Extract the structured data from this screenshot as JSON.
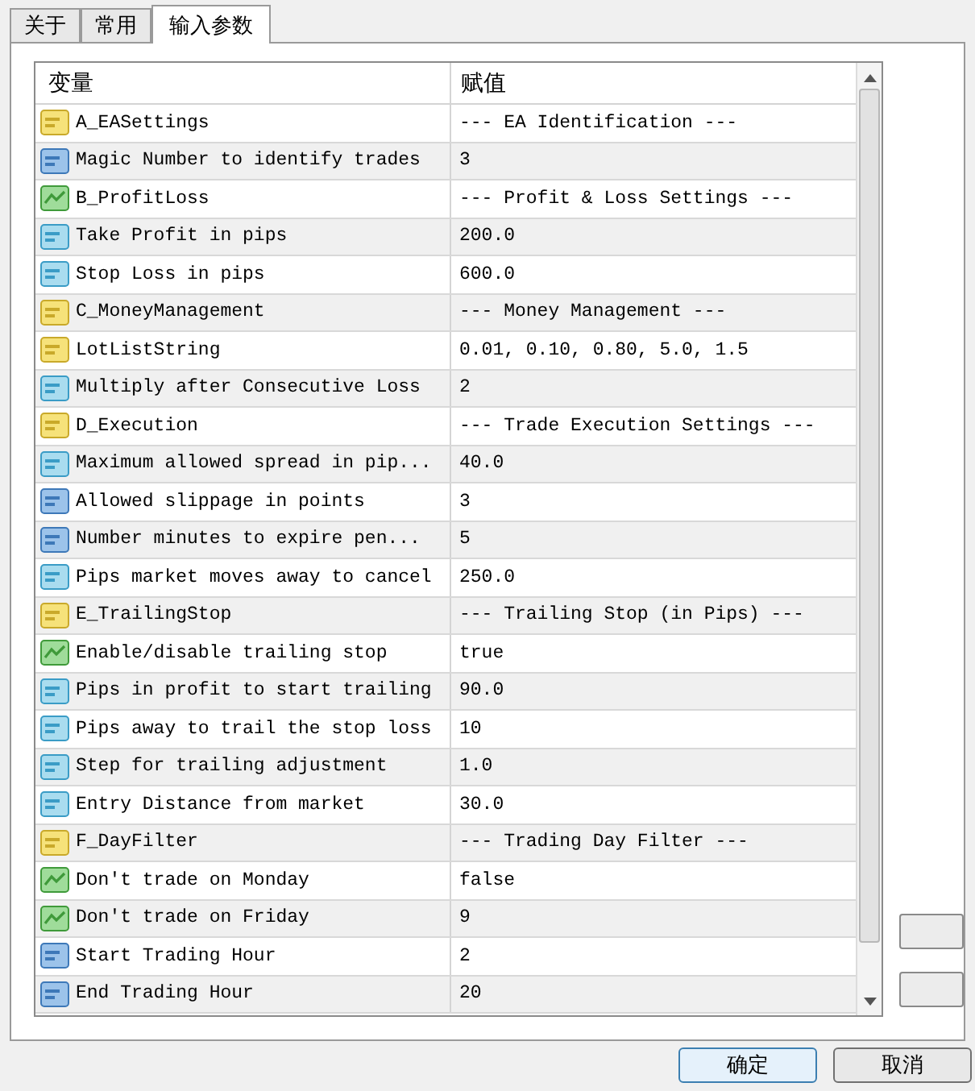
{
  "tabs": [
    {
      "label": "关于",
      "selected": false
    },
    {
      "label": "常用",
      "selected": false
    },
    {
      "label": "输入参数",
      "selected": true
    }
  ],
  "table": {
    "columns": [
      "变量",
      "赋值"
    ],
    "rows": [
      {
        "kind": "string",
        "name": "A_EASettings",
        "value": "--- EA Identification ---"
      },
      {
        "kind": "int",
        "name": "Magic Number to identify trades",
        "value": "3"
      },
      {
        "kind": "bool",
        "name": "B_ProfitLoss",
        "value": "--- Profit & Loss Settings ---"
      },
      {
        "kind": "double",
        "name": "Take Profit in pips",
        "value": "200.0"
      },
      {
        "kind": "double",
        "name": "Stop Loss in pips",
        "value": "600.0"
      },
      {
        "kind": "string",
        "name": "C_MoneyManagement",
        "value": "--- Money Management ---"
      },
      {
        "kind": "string",
        "name": "LotListString",
        "value": "0.01, 0.10, 0.80, 5.0, 1.5"
      },
      {
        "kind": "double",
        "name": "Multiply after Consecutive Loss",
        "value": "2"
      },
      {
        "kind": "string",
        "name": "D_Execution",
        "value": "--- Trade Execution Settings ---"
      },
      {
        "kind": "double",
        "name": "Maximum allowed spread in pip...",
        "value": "40.0"
      },
      {
        "kind": "int",
        "name": "Allowed slippage in points",
        "value": "3"
      },
      {
        "kind": "int",
        "name": "Number minutes to expire pen...",
        "value": "5"
      },
      {
        "kind": "double",
        "name": "Pips market moves away to cancel",
        "value": "250.0"
      },
      {
        "kind": "string",
        "name": "E_TrailingStop",
        "value": "--- Trailing Stop (in Pips) ---"
      },
      {
        "kind": "bool",
        "name": "Enable/disable trailing stop",
        "value": "true"
      },
      {
        "kind": "double",
        "name": "Pips in profit to start trailing",
        "value": "90.0"
      },
      {
        "kind": "double",
        "name": "Pips away to trail the stop loss",
        "value": "10"
      },
      {
        "kind": "double",
        "name": "Step for trailing adjustment",
        "value": "1.0"
      },
      {
        "kind": "double",
        "name": "Entry Distance from market",
        "value": "30.0"
      },
      {
        "kind": "string",
        "name": "F_DayFilter",
        "value": "--- Trading Day Filter ---"
      },
      {
        "kind": "bool",
        "name": "Don't trade on Monday",
        "value": "false"
      },
      {
        "kind": "bool",
        "name": "Don't trade on Friday",
        "value": "9"
      },
      {
        "kind": "int",
        "name": "Start Trading Hour",
        "value": "2"
      },
      {
        "kind": "int",
        "name": "End Trading Hour",
        "value": "20"
      }
    ]
  },
  "buttons": [
    {
      "label": "确定"
    },
    {
      "label": "取消"
    }
  ]
}
